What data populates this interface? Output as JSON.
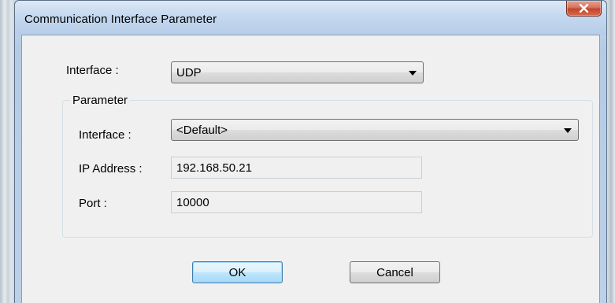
{
  "window": {
    "title": "Communication Interface Parameter"
  },
  "interface": {
    "label": "Interface :",
    "selected": "UDP"
  },
  "parameter_group": {
    "title": "Parameter",
    "interface": {
      "label": "Interface :",
      "selected": "<Default>"
    },
    "ip_address": {
      "label": "IP Address :",
      "value": "192.168.50.21"
    },
    "port": {
      "label": "Port :",
      "value": "10000"
    }
  },
  "buttons": {
    "ok_label": "OK",
    "cancel_label": "Cancel"
  },
  "icons": {
    "close": "close-icon",
    "dropdown": "chevron-down-icon"
  },
  "colors": {
    "close_button": "#c2442b",
    "default_button_border": "#3c7fb1",
    "dialog_background": "#f0f0f0",
    "titlebar": "#c4d8ef"
  }
}
